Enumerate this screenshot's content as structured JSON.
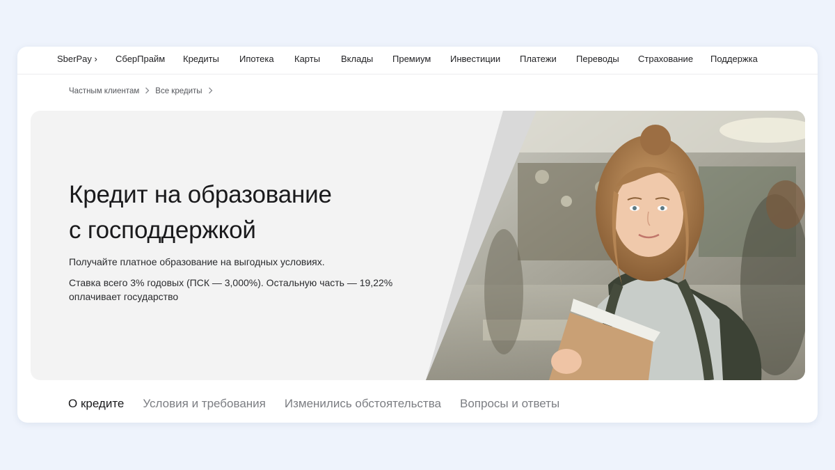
{
  "nav": {
    "items": [
      {
        "label": "SberPay ›"
      },
      {
        "label": "СберПрайм"
      },
      {
        "label": "Кредиты"
      },
      {
        "label": "Ипотека"
      },
      {
        "label": "Карты"
      },
      {
        "label": "Вклады"
      },
      {
        "label": "Премиум"
      },
      {
        "label": "Инвестиции"
      },
      {
        "label": "Платежи"
      },
      {
        "label": "Переводы"
      },
      {
        "label": "Страхование"
      },
      {
        "label": "Поддержка"
      }
    ]
  },
  "breadcrumb": {
    "items": [
      "Частным клиентам",
      "Все кредиты"
    ]
  },
  "hero": {
    "title_line1": "Кредит на образование",
    "title_line2": "с господдержкой",
    "subtitle": "Получайте платное образование на выгодных условиях.",
    "rate_text": "Ставка всего 3% годовых (ПСК — 3,000%). Остальную часть — 19,22% оплачивает государство"
  },
  "tabs": {
    "items": [
      {
        "label": "О кредите"
      },
      {
        "label": "Условия и требования"
      },
      {
        "label": "Изменились обстоятельства"
      },
      {
        "label": "Вопросы и ответы"
      }
    ]
  },
  "colors": {
    "page_bg": "#eef3fc",
    "card_bg": "#ffffff",
    "hero_bg": "#f3f3f3",
    "text_primary": "#1a1a1c",
    "text_muted": "#7b7d82"
  }
}
